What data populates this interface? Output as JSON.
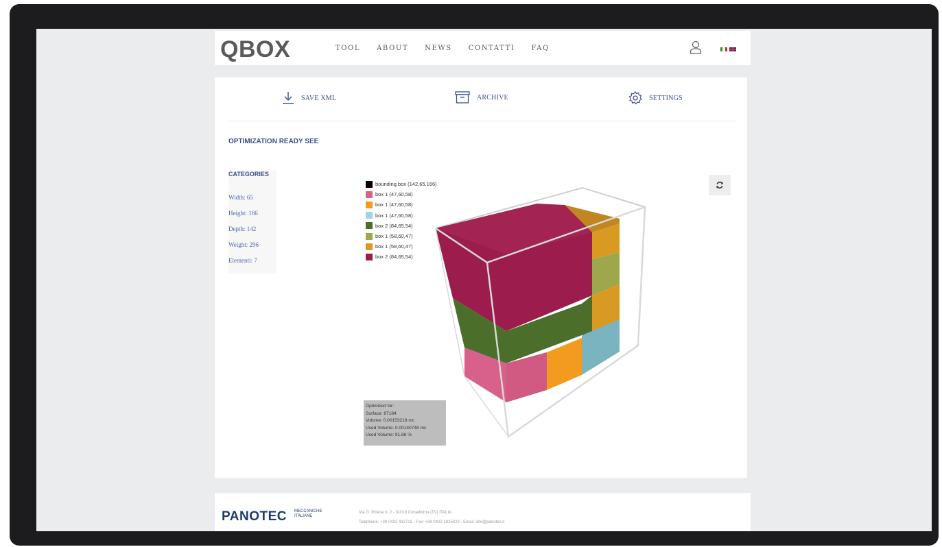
{
  "header": {
    "logo": "QBOX",
    "nav": [
      "TOOL",
      "ABOUT",
      "NEWS",
      "CONTATTI",
      "FAQ"
    ],
    "user_icon": "user-icon",
    "flags": [
      "italian-flag",
      "uk-flag"
    ]
  },
  "toolbar": {
    "save_label": "SAVE XML",
    "archive_label": "ARCHIVE",
    "settings_label": "SETTINGS"
  },
  "main": {
    "status": "OPTIMIZATION READY SEE",
    "categories_title": "CATEGORIES",
    "categories": [
      "Width: 65",
      "Height: 166",
      "Depth: 142",
      "Weight: 296",
      "Elementi: 7"
    ]
  },
  "legend": [
    {
      "label": "bounding box (142,65,166)",
      "color": "#000000"
    },
    {
      "label": "box 1 (47,60,58)",
      "color": "#d8618b"
    },
    {
      "label": "box 1 (47,60,58)",
      "color": "#f39b1e"
    },
    {
      "label": "box 1 (47,60,58)",
      "color": "#9ed3e2"
    },
    {
      "label": "box 2 (84,65,54)",
      "color": "#4b6f2a"
    },
    {
      "label": "box 1 (58,60,47)",
      "color": "#9fa74c"
    },
    {
      "label": "box 1 (58,60,47)",
      "color": "#d99a24"
    },
    {
      "label": "box 2 (84,65,54)",
      "color": "#9c1d4d"
    }
  ],
  "info": [
    "Optimized for:",
    "Surface: 87184",
    "Volume: 0.00153218 mc",
    "Used Volume: 0.00140748 mc",
    "Used Volume: 91.86 %"
  ],
  "footer": {
    "brand": "PANOTEC",
    "brand_sub_1": "MECCANICHE",
    "brand_sub_2": "ITALIANE",
    "address": "Via G. Polese n. 2 - 31010 Cimadolmo (TV) ITALIA",
    "contacts": "Telephone: +39 0422 432715 - Fax: +39 0422 1825423 - Email: info@panotec.it"
  },
  "colors": {
    "accent": "#3b4f8a",
    "magenta": "#9c1d4d",
    "green": "#4b6f2a",
    "pink": "#d8618b",
    "orange": "#f39b1e",
    "lightblue": "#9ed3e2",
    "olive": "#9fa74c",
    "gold": "#d99a24"
  }
}
